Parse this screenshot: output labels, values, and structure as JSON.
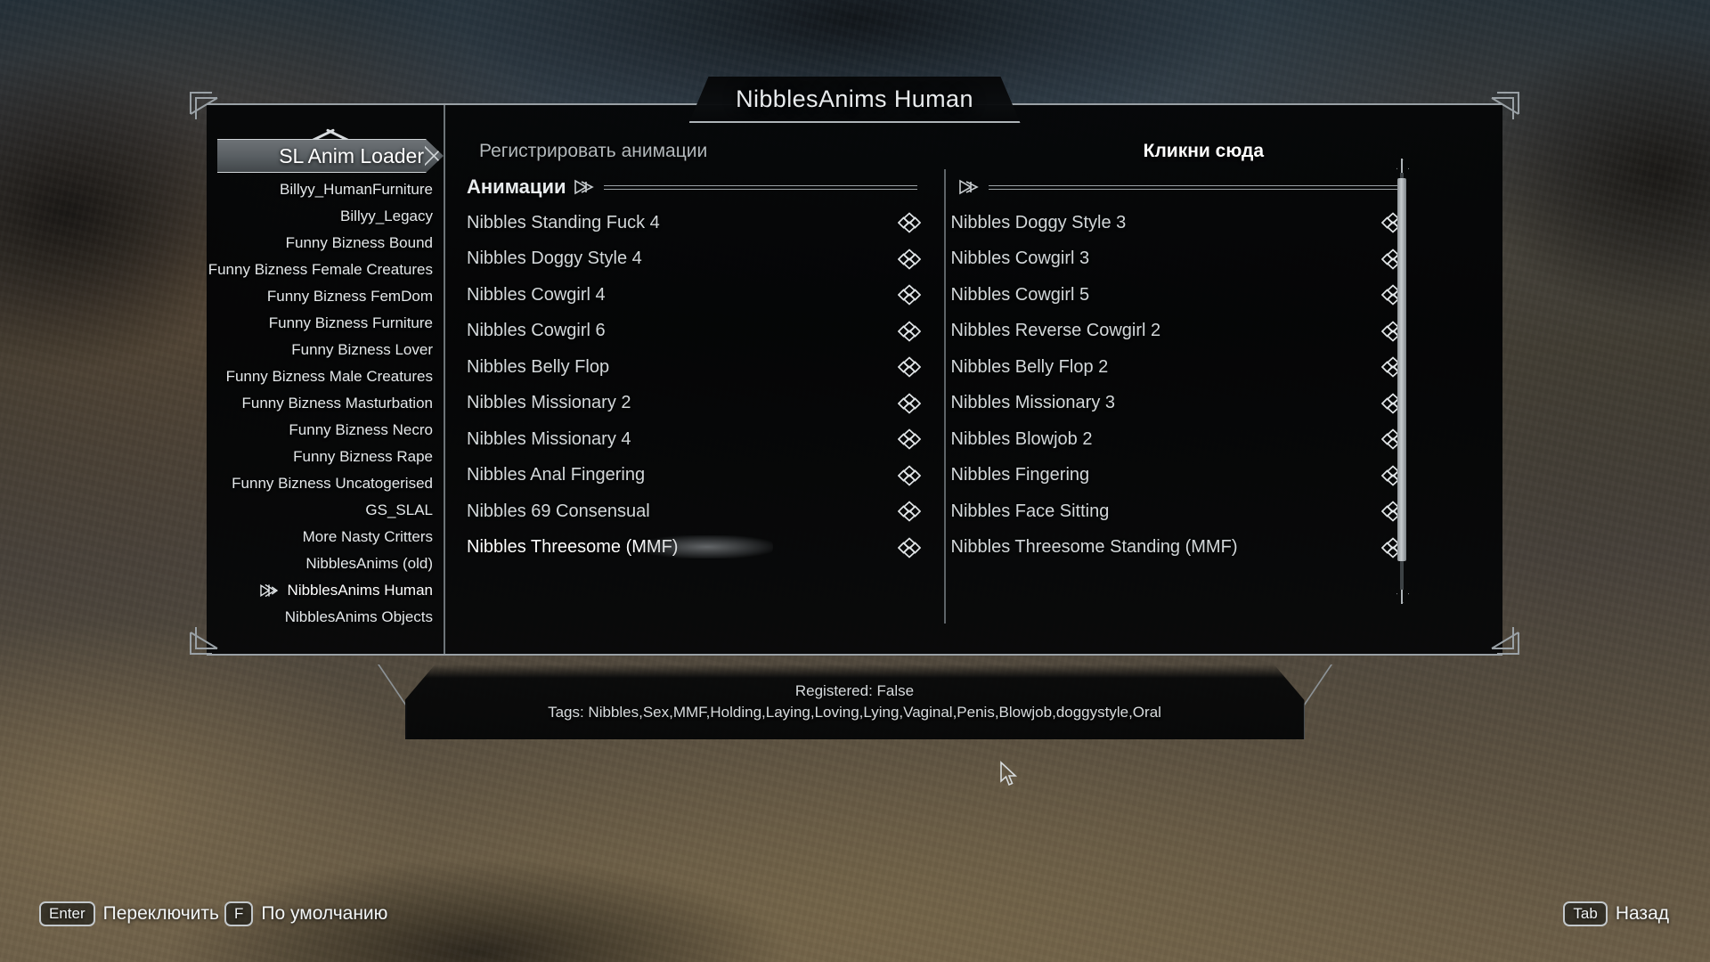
{
  "window": {
    "title": "NibblesAnims Human"
  },
  "sidebar": {
    "selected_header": "SL Anim Loader",
    "scroll_up_icon": "chevron-up-icon",
    "items": [
      {
        "label": "Billyy_HumanFurniture",
        "current": false
      },
      {
        "label": "Billyy_Legacy",
        "current": false
      },
      {
        "label": "Funny Bizness Bound",
        "current": false
      },
      {
        "label": "Funny Bizness Female Creatures",
        "current": false
      },
      {
        "label": "Funny Bizness FemDom",
        "current": false
      },
      {
        "label": "Funny Bizness Furniture",
        "current": false
      },
      {
        "label": "Funny Bizness Lover",
        "current": false
      },
      {
        "label": "Funny Bizness Male Creatures",
        "current": false
      },
      {
        "label": "Funny Bizness Masturbation",
        "current": false
      },
      {
        "label": "Funny Bizness Necro",
        "current": false
      },
      {
        "label": "Funny Bizness Rape",
        "current": false
      },
      {
        "label": "Funny Bizness Uncatogerised",
        "current": false
      },
      {
        "label": "GS_SLAL",
        "current": false
      },
      {
        "label": "More Nasty Critters",
        "current": false
      },
      {
        "label": "NibblesAnims (old)",
        "current": false
      },
      {
        "label": "NibblesAnims Human",
        "current": true
      },
      {
        "label": "NibblesAnims Objects",
        "current": false
      }
    ]
  },
  "content": {
    "register_label": "Регистрировать анимации",
    "register_value": "Кликни сюда",
    "left_column": {
      "header": "Анимации",
      "rows": [
        {
          "label": "Nibbles Standing Fuck 4",
          "highlighted": false
        },
        {
          "label": "Nibbles Doggy Style 4",
          "highlighted": false
        },
        {
          "label": "Nibbles Cowgirl 4",
          "highlighted": false
        },
        {
          "label": "Nibbles Cowgirl 6",
          "highlighted": false
        },
        {
          "label": "Nibbles Belly Flop",
          "highlighted": false
        },
        {
          "label": "Nibbles Missionary 2",
          "highlighted": false
        },
        {
          "label": "Nibbles Missionary 4",
          "highlighted": false
        },
        {
          "label": "Nibbles Anal Fingering",
          "highlighted": false
        },
        {
          "label": "Nibbles 69 Consensual",
          "highlighted": false
        },
        {
          "label": "Nibbles Threesome (MMF)",
          "highlighted": true
        }
      ]
    },
    "right_column": {
      "header": "",
      "rows": [
        {
          "label": "Nibbles Doggy Style 3",
          "highlighted": false
        },
        {
          "label": "Nibbles Cowgirl 3",
          "highlighted": false
        },
        {
          "label": "Nibbles Cowgirl 5",
          "highlighted": false
        },
        {
          "label": "Nibbles Reverse Cowgirl 2",
          "highlighted": false
        },
        {
          "label": "Nibbles Belly Flop 2",
          "highlighted": false
        },
        {
          "label": "Nibbles Missionary 3",
          "highlighted": false
        },
        {
          "label": "Nibbles Blowjob 2",
          "highlighted": false
        },
        {
          "label": "Nibbles Fingering",
          "highlighted": false
        },
        {
          "label": "Nibbles Face Sitting",
          "highlighted": false
        },
        {
          "label": "Nibbles Threesome Standing (MMF)",
          "highlighted": false
        }
      ]
    }
  },
  "infobox": {
    "line1": "Registered: False",
    "line2": "Tags: Nibbles,Sex,MMF,Holding,Laying,Loving,Lying,Vaginal,Penis,Blowjob,doggystyle,Oral"
  },
  "keybar": {
    "hints": [
      {
        "key": "Enter",
        "label": "Переключить"
      },
      {
        "key": "F",
        "label": "По умолчанию"
      },
      {
        "key": "Tab",
        "label": "Назад"
      }
    ]
  }
}
